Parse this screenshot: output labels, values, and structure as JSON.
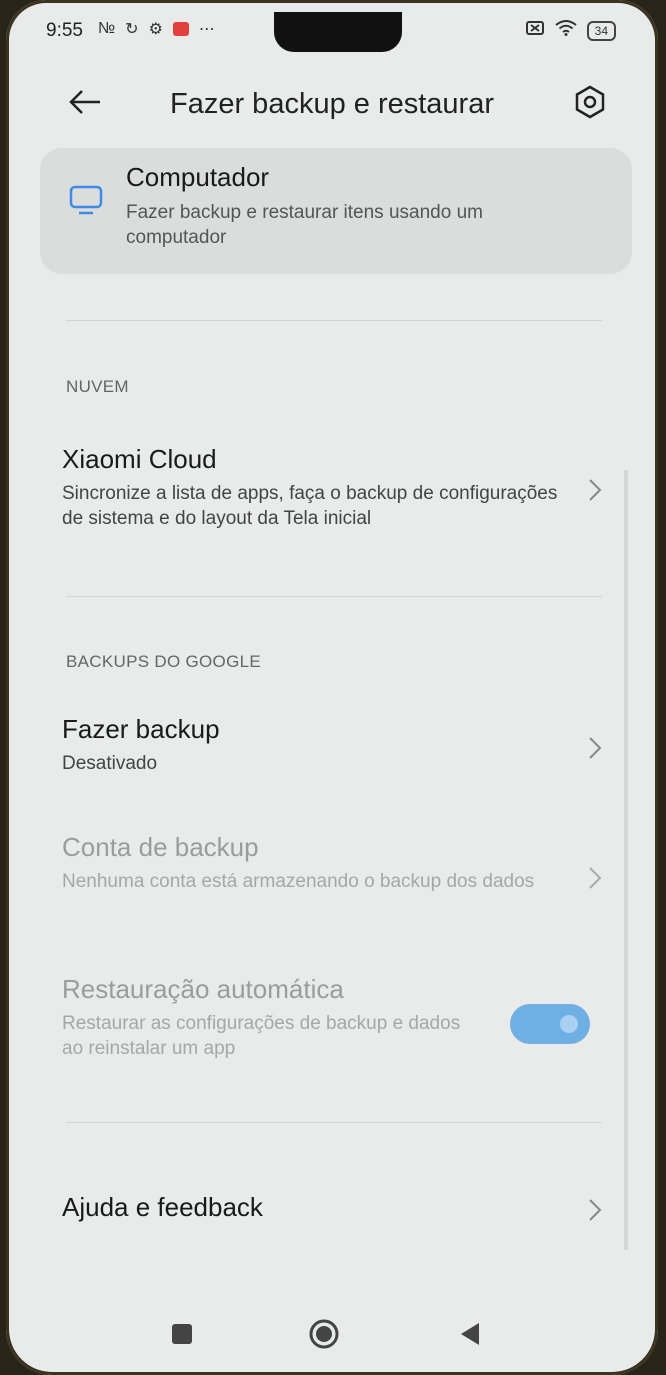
{
  "status_bar": {
    "time": "9:55",
    "battery": "34"
  },
  "header": {
    "title": "Fazer backup e restaurar"
  },
  "computer": {
    "title": "Computador",
    "description": "Fazer backup e restaurar itens usando um computador"
  },
  "cloud_section": {
    "label": "NUVEM",
    "item": {
      "title": "Xiaomi Cloud",
      "description": "Sincronize a lista de apps, faça o backup de configurações de sistema e do layout da Tela inicial"
    }
  },
  "google_section": {
    "label": "BACKUPS DO GOOGLE",
    "backup": {
      "title": "Fazer backup",
      "value": "Desativado"
    },
    "account": {
      "title": "Conta de backup",
      "description": "Nenhuma conta está armazenando o backup dos dados"
    },
    "restore": {
      "title": "Restauração automática",
      "description": "Restaurar as configurações de backup e dados ao reinstalar um app",
      "enabled": true
    }
  },
  "help": {
    "title": "Ajuda e feedback"
  },
  "colors": {
    "background": "#e9eaea",
    "card": "#dbdcdc",
    "accent": "#6fb0e4",
    "computer_icon": "#3c8ce7"
  }
}
